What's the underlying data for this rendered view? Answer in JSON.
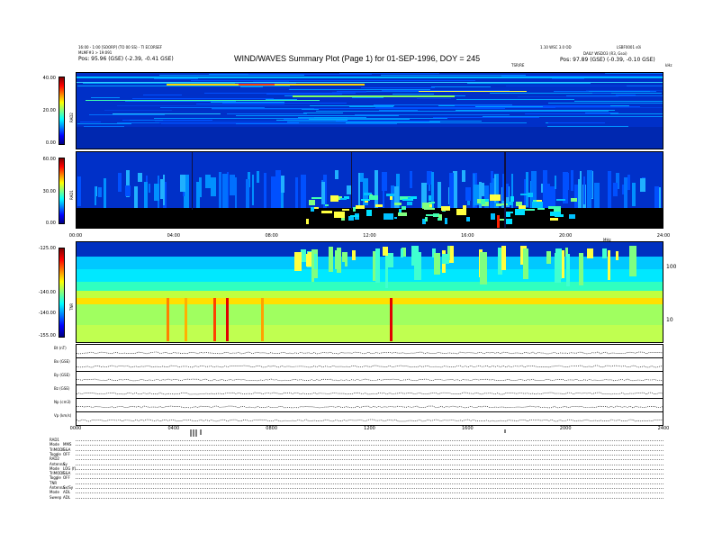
{
  "header": {
    "left_line1": "16:00 - 1:00 [SOORP] (TO 00 SS) - TI ECORSEF",
    "left_line2": "MLMF#3 > 19:091",
    "left_line3": "Pos:   95.96 (GSE) (-2.39, -0.41 GSE)",
    "title": "WIND/WAVES Summary Plot (Page 1) for 01-SEP-1996, DOY = 245",
    "right_line1": "1.10 WSC 3.0 OD",
    "right_line2": "DAILY WSDO3 (R3, Gsoi)",
    "right_line3": "Pos:   97.89 (GSE) (-0.39, -0.10 GSE)",
    "corner": "LSBF0001 s0i",
    "khz": "kHz",
    "tile_label": "TSR/RE"
  },
  "chart_data": [
    {
      "type": "heatmap",
      "ylabel": "RAD2",
      "ylim": [
        0,
        40
      ],
      "yticks": [
        "40.00",
        "20.00",
        "0.00"
      ]
    },
    {
      "type": "heatmap",
      "ylabel": "RAD1",
      "ylim": [
        0,
        60
      ],
      "yticks": [
        "60.00",
        "30.00",
        "0.00"
      ],
      "xticks": [
        "00:00",
        "04:00",
        "08:00",
        "12:00",
        "16:00",
        "20:00",
        "24:00"
      ],
      "xlim_hours": [
        0,
        24
      ]
    },
    {
      "type": "heatmap",
      "ylabel": "TNR",
      "ylim": [
        -155,
        -125
      ],
      "yticks": [
        "-125.00",
        "-140.00",
        "-140.00",
        "-155.00"
      ],
      "right_ticks": [
        "100",
        "10"
      ],
      "right_corner": "MHz"
    },
    {
      "type": "line",
      "strips": [
        {
          "label": "Bt (nT)"
        },
        {
          "label": "Bx (GSE)"
        },
        {
          "label": "By (GSE)"
        },
        {
          "label": "Bz (GSE)"
        },
        {
          "label": "Np (cm3)"
        },
        {
          "label": "Vp (km/s)"
        }
      ],
      "xticks": [
        "0000",
        "0400",
        "0800",
        "1200",
        "1600",
        "2000",
        "2400"
      ]
    }
  ],
  "footer": {
    "rows": [
      {
        "label": "RAD1",
        "value": ""
      },
      {
        "label": "Mode",
        "value": "MMS"
      },
      {
        "label": "TriMODE",
        "value": "S&A"
      },
      {
        "label": "Toggle",
        "value": "OFF"
      },
      {
        "label": "RAD2",
        "value": ""
      },
      {
        "label": "Antenna",
        "value": "Sy"
      },
      {
        "label": "Mode",
        "value": "LOG (f)"
      },
      {
        "label": "TriMODE",
        "value": "S&A"
      },
      {
        "label": "Toggle",
        "value": "OFF"
      },
      {
        "label": "TNR",
        "value": ""
      },
      {
        "label": "Antenna",
        "value": "Sx/Sy"
      },
      {
        "label": "Mode",
        "value": "ADL"
      },
      {
        "label": "Sweep",
        "value": "ADL"
      }
    ]
  },
  "colors": {
    "colorbar": [
      "#7f0000",
      "#ff0000",
      "#ff8000",
      "#ffff00",
      "#80ff80",
      "#00ffff",
      "#0080ff",
      "#0000ff",
      "#000080"
    ],
    "background_blue": "#0030c0",
    "noise_black": "#000000"
  }
}
